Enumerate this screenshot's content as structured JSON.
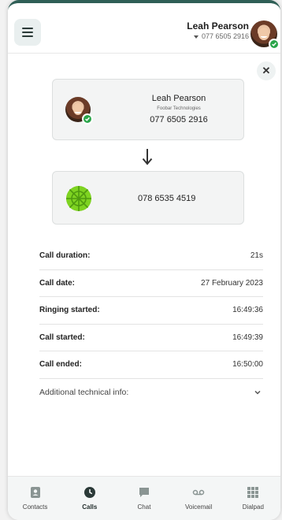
{
  "header": {
    "menu_icon": "hamburger-menu-icon",
    "user_name": "Leah Pearson",
    "user_phone": "077 6505 2916",
    "status": "online"
  },
  "call": {
    "from": {
      "name": "Leah Pearson",
      "company": "Foobar Technologies",
      "number": "077 6505 2916"
    },
    "to": {
      "number": "078 6535 4519"
    }
  },
  "details": {
    "rows": [
      {
        "label": "Call duration:",
        "value": "21s"
      },
      {
        "label": "Call date:",
        "value": "27 February 2023"
      },
      {
        "label": "Ringing started:",
        "value": "16:49:36"
      },
      {
        "label": "Call started:",
        "value": "16:49:39"
      },
      {
        "label": "Call ended:",
        "value": "16:50:00"
      }
    ],
    "technical_label": "Additional technical info:"
  },
  "nav": {
    "items": [
      {
        "label": "Contacts",
        "icon": "contacts-icon"
      },
      {
        "label": "Calls",
        "icon": "clock-icon"
      },
      {
        "label": "Chat",
        "icon": "chat-icon"
      },
      {
        "label": "Voicemail",
        "icon": "voicemail-icon"
      },
      {
        "label": "Dialpad",
        "icon": "dialpad-icon"
      }
    ],
    "active": "Calls"
  },
  "colors": {
    "accent": "#2f5f56",
    "online": "#2aa54a",
    "logo_green": "#7ed321"
  }
}
